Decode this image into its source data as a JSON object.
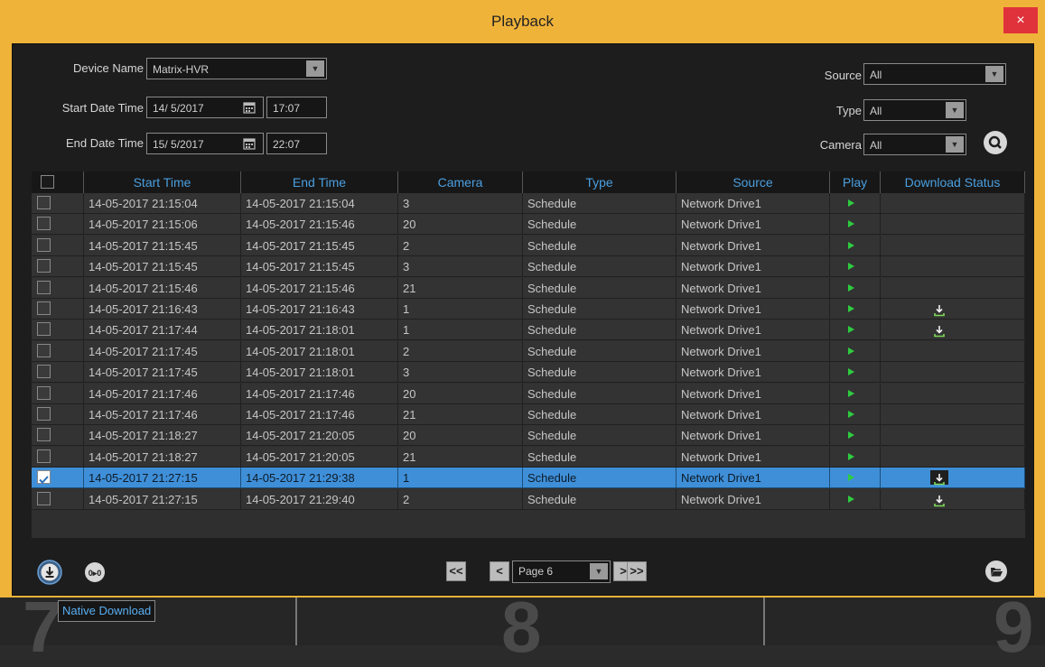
{
  "window": {
    "title": "Playback",
    "close_label": "×"
  },
  "form": {
    "device_name_label": "Device Name",
    "device_name_value": "Matrix-HVR",
    "start_label": "Start Date Time",
    "start_date": "14/ 5/2017",
    "start_time": "17:07",
    "end_label": "End Date Time",
    "end_date": "15/ 5/2017",
    "end_time": "22:07",
    "source_label": "Source",
    "source_value": "All",
    "type_label": "Type",
    "type_value": "All",
    "camera_label": "Camera",
    "camera_value": "All"
  },
  "table": {
    "headers": [
      "Start Time",
      "End Time",
      "Camera",
      "Type",
      "Source",
      "Play",
      "Download Status"
    ],
    "rows": [
      {
        "start": "14-05-2017 21:15:04",
        "end": "14-05-2017 21:15:04",
        "camera": "3",
        "type": "Schedule",
        "source": "Network Drive1",
        "download": false,
        "checked": false
      },
      {
        "start": "14-05-2017 21:15:06",
        "end": "14-05-2017 21:15:46",
        "camera": "20",
        "type": "Schedule",
        "source": "Network Drive1",
        "download": false,
        "checked": false
      },
      {
        "start": "14-05-2017 21:15:45",
        "end": "14-05-2017 21:15:45",
        "camera": "2",
        "type": "Schedule",
        "source": "Network Drive1",
        "download": false,
        "checked": false
      },
      {
        "start": "14-05-2017 21:15:45",
        "end": "14-05-2017 21:15:45",
        "camera": "3",
        "type": "Schedule",
        "source": "Network Drive1",
        "download": false,
        "checked": false
      },
      {
        "start": "14-05-2017 21:15:46",
        "end": "14-05-2017 21:15:46",
        "camera": "21",
        "type": "Schedule",
        "source": "Network Drive1",
        "download": false,
        "checked": false
      },
      {
        "start": "14-05-2017 21:16:43",
        "end": "14-05-2017 21:16:43",
        "camera": "1",
        "type": "Schedule",
        "source": "Network Drive1",
        "download": true,
        "checked": false
      },
      {
        "start": "14-05-2017 21:17:44",
        "end": "14-05-2017 21:18:01",
        "camera": "1",
        "type": "Schedule",
        "source": "Network Drive1",
        "download": true,
        "checked": false
      },
      {
        "start": "14-05-2017 21:17:45",
        "end": "14-05-2017 21:18:01",
        "camera": "2",
        "type": "Schedule",
        "source": "Network Drive1",
        "download": false,
        "checked": false
      },
      {
        "start": "14-05-2017 21:17:45",
        "end": "14-05-2017 21:18:01",
        "camera": "3",
        "type": "Schedule",
        "source": "Network Drive1",
        "download": false,
        "checked": false
      },
      {
        "start": "14-05-2017 21:17:46",
        "end": "14-05-2017 21:17:46",
        "camera": "20",
        "type": "Schedule",
        "source": "Network Drive1",
        "download": false,
        "checked": false
      },
      {
        "start": "14-05-2017 21:17:46",
        "end": "14-05-2017 21:17:46",
        "camera": "21",
        "type": "Schedule",
        "source": "Network Drive1",
        "download": false,
        "checked": false
      },
      {
        "start": "14-05-2017 21:18:27",
        "end": "14-05-2017 21:20:05",
        "camera": "20",
        "type": "Schedule",
        "source": "Network Drive1",
        "download": false,
        "checked": false
      },
      {
        "start": "14-05-2017 21:18:27",
        "end": "14-05-2017 21:20:05",
        "camera": "21",
        "type": "Schedule",
        "source": "Network Drive1",
        "download": false,
        "checked": false
      },
      {
        "start": "14-05-2017 21:27:15",
        "end": "14-05-2017 21:29:38",
        "camera": "1",
        "type": "Schedule",
        "source": "Network Drive1",
        "download": true,
        "checked": true
      },
      {
        "start": "14-05-2017 21:27:15",
        "end": "14-05-2017 21:29:40",
        "camera": "2",
        "type": "Schedule",
        "source": "Network Drive1",
        "download": true,
        "checked": false
      }
    ]
  },
  "pager": {
    "page_label": "Page 6",
    "first": "<<",
    "prev": "<",
    "next": ">",
    "last": ">>"
  },
  "tooltip": {
    "text": "Native Download"
  },
  "background": {
    "digit_left": "7",
    "digit_mid": "8",
    "digit_right": "9"
  },
  "colors": {
    "accent": "#f0b33a",
    "header_text": "#4a9fe0",
    "selected_row": "#3f8fd8",
    "play": "#2ecc40"
  }
}
